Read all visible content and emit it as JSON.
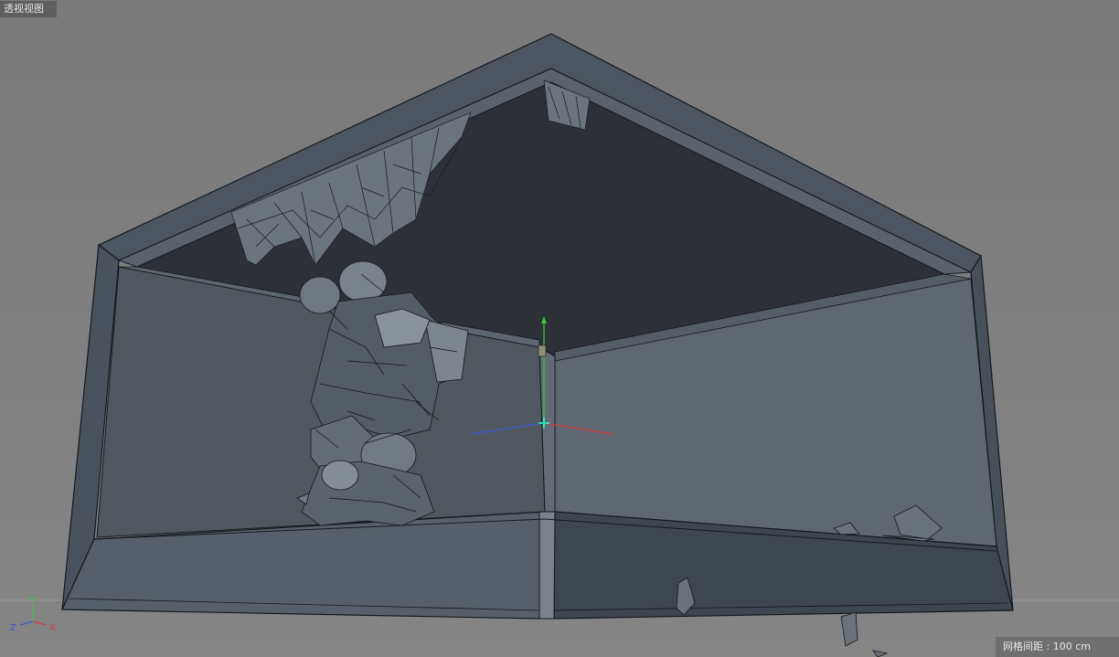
{
  "viewport": {
    "title": "透视视图",
    "grid_spacing_label": "网格间距 : 100 cm"
  },
  "axis_gizmo": {
    "y_label": "Y",
    "x_label": "X",
    "z_label": "Z",
    "y_color": "#3fc63f",
    "x_color": "#d23a3a",
    "z_color": "#3a5ad2"
  },
  "colors": {
    "background": "#7e7e7e",
    "room_frame": "#4f5964",
    "ceiling": "#2e3137",
    "wall": "#525962",
    "wireframe": "#1a1d21",
    "handle": "#2ee0b0"
  }
}
